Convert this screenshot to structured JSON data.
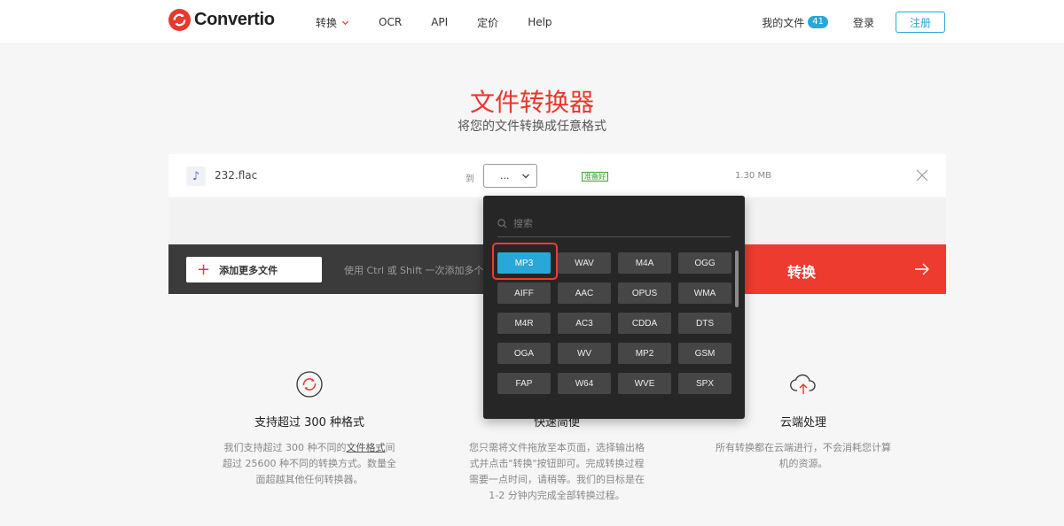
{
  "header": {
    "brand": "Convertio",
    "nav": [
      "转换",
      "OCR",
      "API",
      "定价",
      "Help"
    ],
    "my_files": "我的文件",
    "file_count": "41",
    "login": "登录",
    "signup": "注册"
  },
  "hero": {
    "title": "文件转换器",
    "subtitle": "将您的文件转换成任意格式"
  },
  "file": {
    "name": "232.flac",
    "to_label": "到",
    "format_value": "...",
    "status": "准备好",
    "size": "1.30 MB"
  },
  "actions": {
    "add_more": "添加更多文件",
    "hint": "使用 Ctrl 或 Shift 一次添加多个文件",
    "convert": "转换"
  },
  "dropdown": {
    "search_placeholder": "搜索",
    "formats": [
      "MP3",
      "WAV",
      "M4A",
      "OGG",
      "AIFF",
      "AAC",
      "OPUS",
      "WMA",
      "M4R",
      "AC3",
      "CDDA",
      "DTS",
      "OGA",
      "WV",
      "MP2",
      "GSM",
      "FAP",
      "W64",
      "WVE",
      "SPX"
    ],
    "selected": "MP3"
  },
  "features": [
    {
      "title": "支持超过 300 种格式",
      "text_before": "我们支持超过 300 种不同的",
      "link": "文件格式",
      "text_after": "间超过 25600 种不同的转换方式。数量全面超越其他任何转换器。"
    },
    {
      "title": "快速简便",
      "text": "您只需将文件拖放至本页面，选择输出格式并点击\"转换\"按钮即可。完成转换过程需要一点时间，请稍等。我们的目标是在 1-2 分钟内完成全部转换过程。"
    },
    {
      "title": "云端处理",
      "text": "所有转换都在云端进行，不会消耗您计算机的资源。"
    }
  ],
  "colors": {
    "brand_red": "#e6392f",
    "accent_blue": "#2aa7d8",
    "dark_bar": "#3b3b3b",
    "dropdown_bg": "#262626"
  }
}
